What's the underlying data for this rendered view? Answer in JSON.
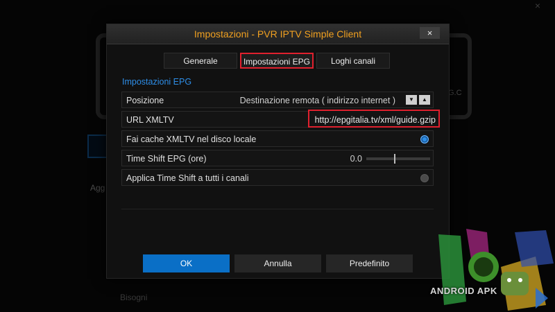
{
  "background": {
    "close_glyph": "×",
    "panel_text": "G.C",
    "label_1": "Agg",
    "label_2": "Bisogni"
  },
  "dialog": {
    "title": "Impostazioni - PVR IPTV Simple Client",
    "close_glyph": "×",
    "tabs": [
      {
        "label": "Generale",
        "active": false
      },
      {
        "label": "Impostazioni EPG",
        "active": true
      },
      {
        "label": "Loghi canali",
        "active": false
      }
    ],
    "section_title": "Impostazioni EPG",
    "settings": {
      "position": {
        "label": "Posizione",
        "value": "Destinazione remota ( indirizzo internet )",
        "down_icon": "▼",
        "up_icon": "▲"
      },
      "xmltv_url": {
        "label": "URL XMLTV",
        "value": "http://epgitalia.tv/xml/guide.gzip"
      },
      "cache": {
        "label": "Fai cache XMLTV nel disco locale",
        "enabled": true
      },
      "time_shift": {
        "label": "Time Shift EPG (ore)",
        "value": "0.0"
      },
      "apply_all": {
        "label": "Applica Time Shift a tutti i canali",
        "enabled": false
      }
    },
    "buttons": {
      "ok": "OK",
      "cancel": "Annulla",
      "default": "Predefinito"
    }
  },
  "watermark": {
    "text": "ANDROID APK"
  },
  "colors": {
    "accent_title": "#f0a020",
    "section": "#2e8ee8",
    "highlight": "#e0202e",
    "primary_button": "#0a6fc6"
  }
}
